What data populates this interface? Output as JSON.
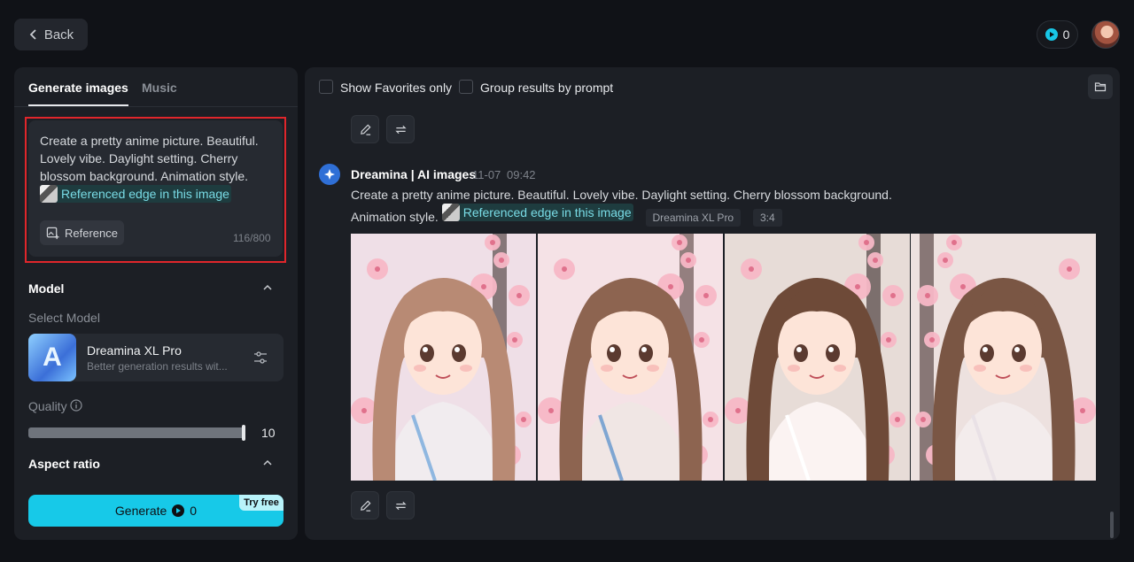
{
  "header": {
    "back_label": "Back",
    "credits": "0"
  },
  "tabs": [
    {
      "label": "Generate images",
      "active": true
    },
    {
      "label": "Music",
      "active": false
    }
  ],
  "prompt": {
    "text": "Create a pretty anime picture. Beautiful. Lovely vibe. Daylight setting. Cherry blossom background. Animation style.",
    "reference_chip": "Referenced edge in this image",
    "reference_button": "Reference",
    "char_count": "116/800"
  },
  "model_section": {
    "title": "Model",
    "select_label": "Select Model",
    "model_name": "Dreamina XL Pro",
    "model_desc": "Better generation results wit..."
  },
  "quality": {
    "label": "Quality",
    "value": "10",
    "fraction": 1.0
  },
  "aspect_ratio": {
    "title": "Aspect ratio"
  },
  "generate": {
    "label": "Generate",
    "cost": "0",
    "badge": "Try free"
  },
  "filters": {
    "favorites_label": "Show Favorites only",
    "group_label": "Group results by prompt"
  },
  "message": {
    "author": "Dreamina | AI images",
    "date": "11-07",
    "time": "09:42",
    "text": "Create a pretty anime picture. Beautiful. Lovely vibe. Daylight setting. Cherry blossom background. Animation style.",
    "reference_chip": "Referenced edge in this image",
    "model_tag": "Dreamina XL Pro",
    "ratio_tag": "3:4"
  },
  "colors": {
    "accent": "#17c9e8",
    "highlight_outline": "#e0262b",
    "panel": "#1c1f25",
    "background": "#101217"
  },
  "icons": [
    "chevron-left-icon",
    "play-coin-icon",
    "image-plus-icon",
    "chevron-up-icon",
    "sliders-icon",
    "info-icon",
    "folder-icon",
    "edit-icon",
    "regenerate-icon",
    "dreamina-logo-icon"
  ]
}
